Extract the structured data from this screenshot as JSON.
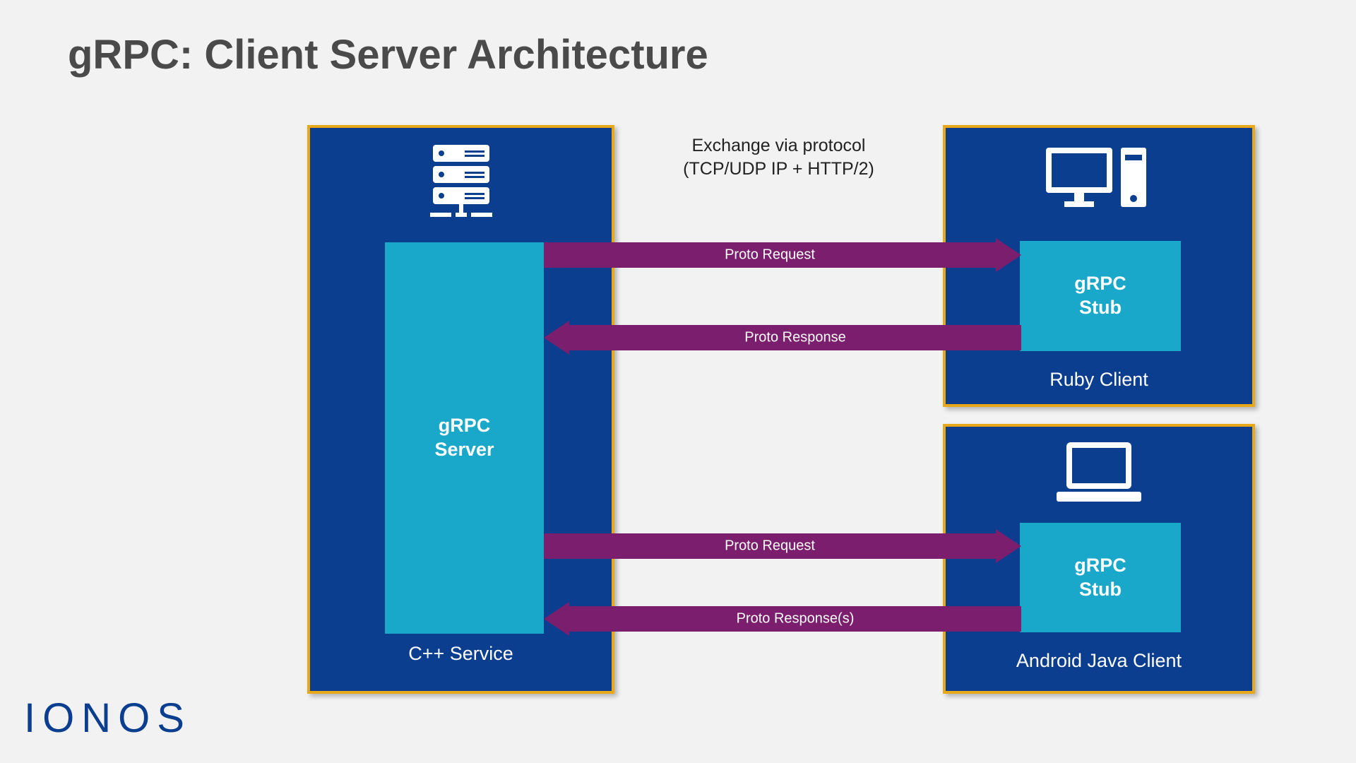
{
  "title": "gRPC: Client Server Architecture",
  "logo": "IONOS",
  "protocol_note_line1": "Exchange via protocol",
  "protocol_note_line2": "(TCP/UDP IP + HTTP/2)",
  "server": {
    "inner_label_l1": "gRPC",
    "inner_label_l2": "Server",
    "caption": "C++ Service"
  },
  "client_ruby": {
    "stub_l1": "gRPC",
    "stub_l2": "Stub",
    "caption": "Ruby Client"
  },
  "client_android": {
    "stub_l1": "gRPC",
    "stub_l2": "Stub",
    "caption": "Android Java Client"
  },
  "arrows": {
    "req1": "Proto Request",
    "resp1": "Proto Response",
    "req2": "Proto Request",
    "resp2": "Proto Response(s)"
  },
  "colors": {
    "box_bg": "#0b3e8f",
    "box_border": "#e8a817",
    "inner_bg": "#19a8c9",
    "arrow": "#7a1e6d",
    "title": "#4a4a4a",
    "logo": "#0b3e8f"
  }
}
